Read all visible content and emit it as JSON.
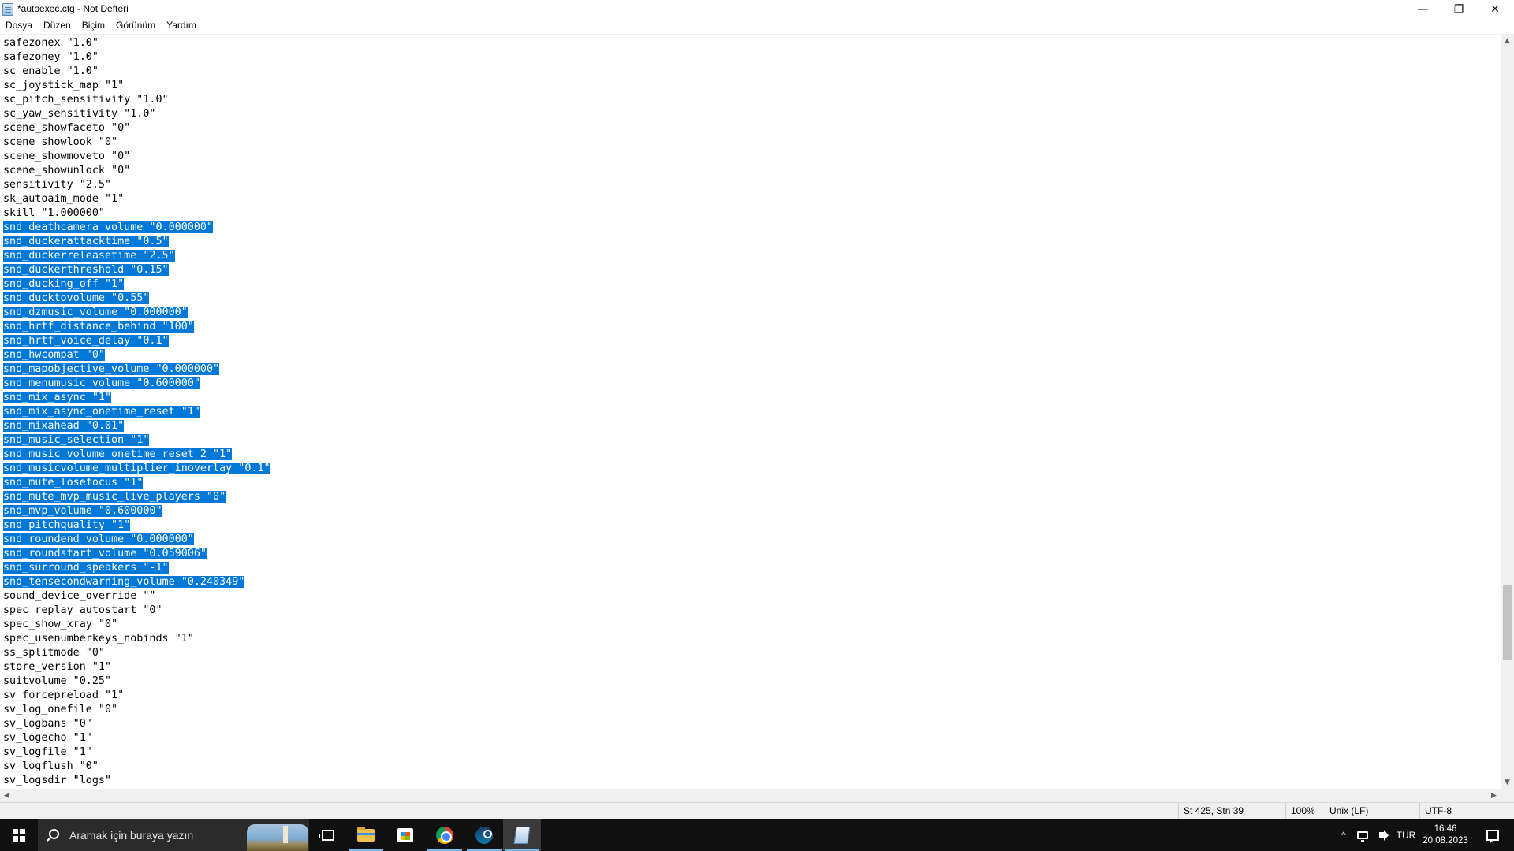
{
  "window": {
    "title": "*autoexec.cfg - Not Defteri",
    "min_glyph": "—",
    "max_glyph": "❐",
    "close_glyph": "✕"
  },
  "menu": [
    "Dosya",
    "Düzen",
    "Biçim",
    "Görünüm",
    "Yardım"
  ],
  "editor": {
    "selection_color": "#0078d7",
    "lines": [
      {
        "text": "safezonex \"1.0\"",
        "selected": false
      },
      {
        "text": "safezoney \"1.0\"",
        "selected": false
      },
      {
        "text": "sc_enable \"1.0\"",
        "selected": false
      },
      {
        "text": "sc_joystick_map \"1\"",
        "selected": false
      },
      {
        "text": "sc_pitch_sensitivity \"1.0\"",
        "selected": false
      },
      {
        "text": "sc_yaw_sensitivity \"1.0\"",
        "selected": false
      },
      {
        "text": "scene_showfaceto \"0\"",
        "selected": false
      },
      {
        "text": "scene_showlook \"0\"",
        "selected": false
      },
      {
        "text": "scene_showmoveto \"0\"",
        "selected": false
      },
      {
        "text": "scene_showunlock \"0\"",
        "selected": false
      },
      {
        "text": "sensitivity \"2.5\"",
        "selected": false
      },
      {
        "text": "sk_autoaim_mode \"1\"",
        "selected": false
      },
      {
        "text": "skill \"1.000000\"",
        "selected": false
      },
      {
        "text": "snd_deathcamera_volume \"0.000000\"",
        "selected": true
      },
      {
        "text": "snd_duckerattacktime \"0.5\"",
        "selected": true
      },
      {
        "text": "snd_duckerreleasetime \"2.5\"",
        "selected": true
      },
      {
        "text": "snd_duckerthreshold \"0.15\"",
        "selected": true
      },
      {
        "text": "snd_ducking_off \"1\"",
        "selected": true
      },
      {
        "text": "snd_ducktovolume \"0.55\"",
        "selected": true
      },
      {
        "text": "snd_dzmusic_volume \"0.000000\"",
        "selected": true
      },
      {
        "text": "snd_hrtf_distance_behind \"100\"",
        "selected": true
      },
      {
        "text": "snd_hrtf_voice_delay \"0.1\"",
        "selected": true
      },
      {
        "text": "snd_hwcompat \"0\"",
        "selected": true
      },
      {
        "text": "snd_mapobjective_volume \"0.000000\"",
        "selected": true
      },
      {
        "text": "snd_menumusic_volume \"0.600000\"",
        "selected": true
      },
      {
        "text": "snd_mix_async \"1\"",
        "selected": true
      },
      {
        "text": "snd_mix_async_onetime_reset \"1\"",
        "selected": true
      },
      {
        "text": "snd_mixahead \"0.01\"",
        "selected": true
      },
      {
        "text": "snd_music_selection \"1\"",
        "selected": true
      },
      {
        "text": "snd_music_volume_onetime_reset_2 \"1\"",
        "selected": true
      },
      {
        "text": "snd_musicvolume_multiplier_inoverlay \"0.1\"",
        "selected": true
      },
      {
        "text": "snd_mute_losefocus \"1\"",
        "selected": true
      },
      {
        "text": "snd_mute_mvp_music_live_players \"0\"",
        "selected": true
      },
      {
        "text": "snd_mvp_volume \"0.600000\"",
        "selected": true
      },
      {
        "text": "snd_pitchquality \"1\"",
        "selected": true
      },
      {
        "text": "snd_roundend_volume \"0.000000\"",
        "selected": true
      },
      {
        "text": "snd_roundstart_volume \"0.059006\"",
        "selected": true
      },
      {
        "text": "snd_surround_speakers \"-1\"",
        "selected": true
      },
      {
        "text": "snd_tensecondwarning_volume \"0.240349\"",
        "selected": true
      },
      {
        "text": "sound_device_override \"\"",
        "selected": false
      },
      {
        "text": "spec_replay_autostart \"0\"",
        "selected": false
      },
      {
        "text": "spec_show_xray \"0\"",
        "selected": false
      },
      {
        "text": "spec_usenumberkeys_nobinds \"1\"",
        "selected": false
      },
      {
        "text": "ss_splitmode \"0\"",
        "selected": false
      },
      {
        "text": "store_version \"1\"",
        "selected": false
      },
      {
        "text": "suitvolume \"0.25\"",
        "selected": false
      },
      {
        "text": "sv_forcepreload \"1\"",
        "selected": false
      },
      {
        "text": "sv_log_onefile \"0\"",
        "selected": false
      },
      {
        "text": "sv_logbans \"0\"",
        "selected": false
      },
      {
        "text": "sv_logecho \"1\"",
        "selected": false
      },
      {
        "text": "sv_logfile \"1\"",
        "selected": false
      },
      {
        "text": "sv_logflush \"0\"",
        "selected": false
      },
      {
        "text": "sv_logsdir \"logs\"",
        "selected": false
      }
    ]
  },
  "scrollbars": {
    "up": "▲",
    "down": "▼",
    "left": "◀",
    "right": "▶"
  },
  "status": {
    "position": "St 425, Stn 39",
    "zoom": "100%",
    "line_ending": "Unix (LF)",
    "encoding": "UTF-8"
  },
  "taskbar": {
    "search_placeholder": "Aramak için buraya yazın",
    "tray_chevron": "^",
    "language": "TUR",
    "time": "16:46",
    "date": "20.08.2023",
    "active_indicator_color": "#76b9ed"
  }
}
